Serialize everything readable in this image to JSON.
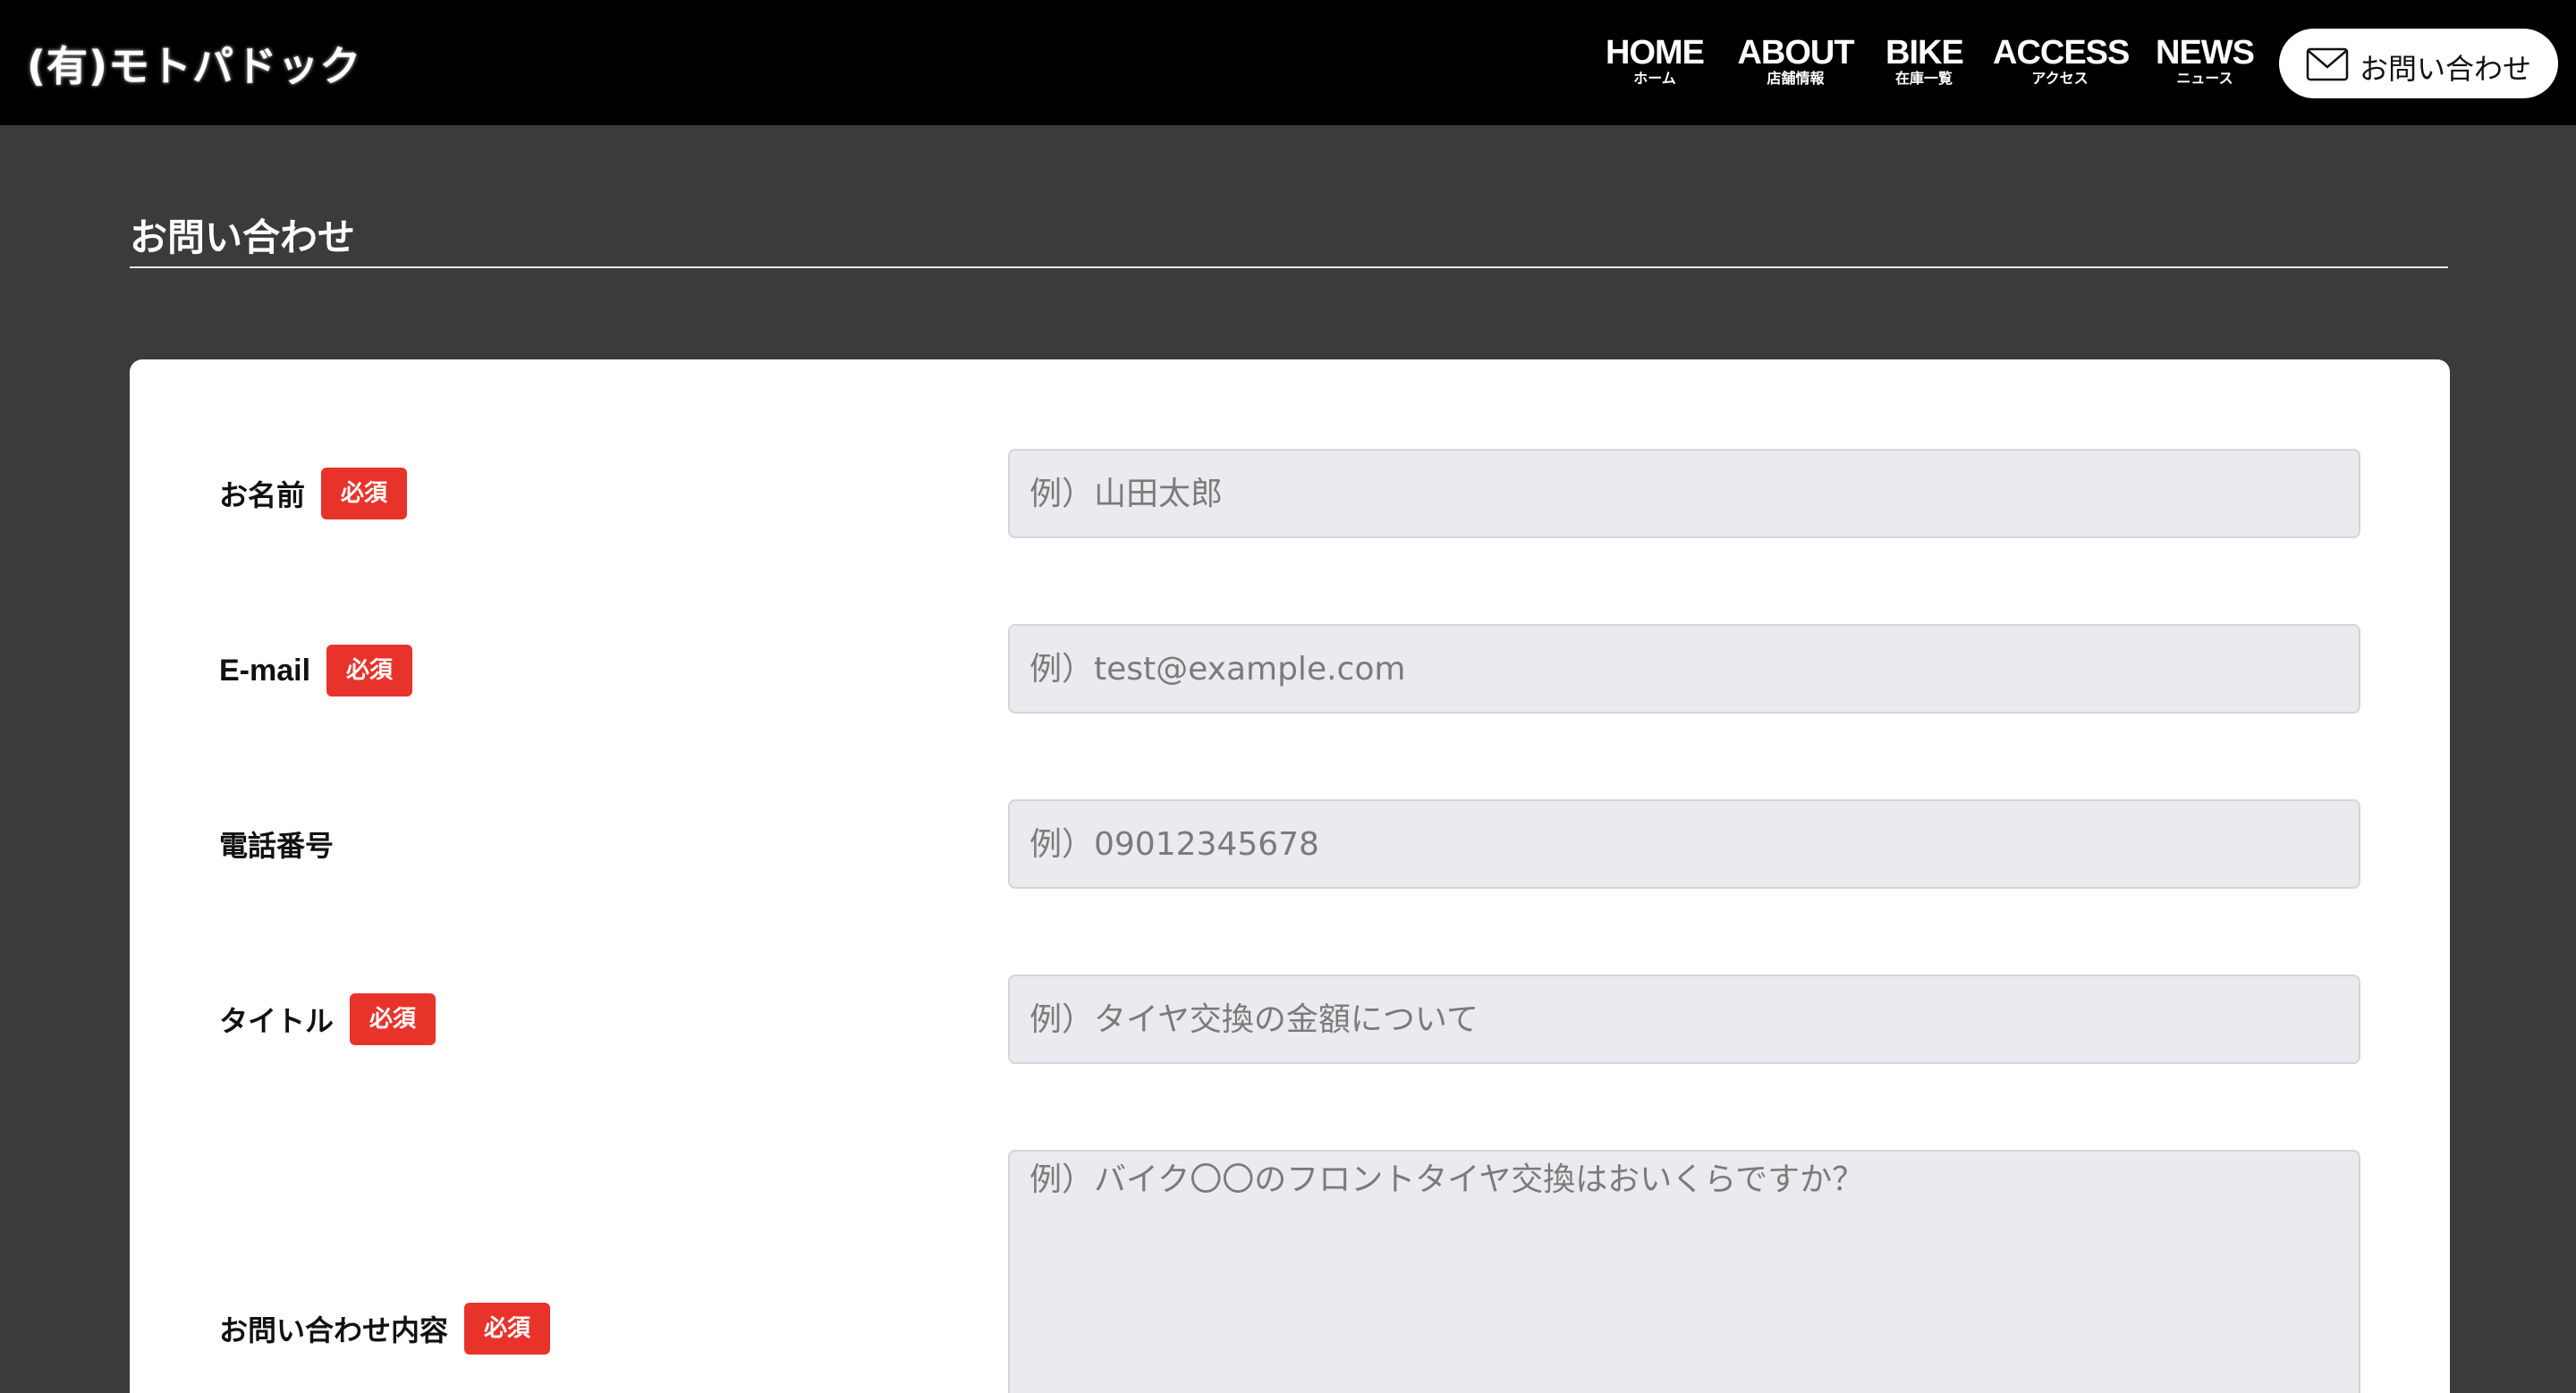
{
  "header": {
    "logo": "(有)モトパドック",
    "nav": [
      {
        "main": "HOME",
        "sub": "ホーム"
      },
      {
        "main": "ABOUT",
        "sub": "店舗情報"
      },
      {
        "main": "BIKE",
        "sub": "在庫一覧"
      },
      {
        "main": "ACCESS",
        "sub": "アクセス"
      },
      {
        "main": "NEWS",
        "sub": "ニュース"
      }
    ],
    "contact_button": {
      "label": "お問い合わせ",
      "icon": "mail-icon"
    }
  },
  "page": {
    "title": "お問い合わせ"
  },
  "form": {
    "required_badge": "必須",
    "fields": [
      {
        "label": "お名前",
        "required": true,
        "placeholder": "例）山田太郎",
        "value": ""
      },
      {
        "label": "E-mail",
        "required": true,
        "placeholder": "例）test@example.com",
        "value": ""
      },
      {
        "label": "電話番号",
        "required": false,
        "placeholder": "例）09012345678",
        "value": ""
      },
      {
        "label": "タイトル",
        "required": true,
        "placeholder": "例）タイヤ交換の金額について",
        "value": ""
      },
      {
        "label": "お問い合わせ内容",
        "required": true,
        "placeholder": "例）バイク〇〇のフロントタイヤ交換はおいくらですか？",
        "value": ""
      }
    ]
  },
  "colors": {
    "header_bg": "#000000",
    "page_bg": "#3b3b3b",
    "required_badge": "#e8332a",
    "field_bg": "#ebebef"
  }
}
